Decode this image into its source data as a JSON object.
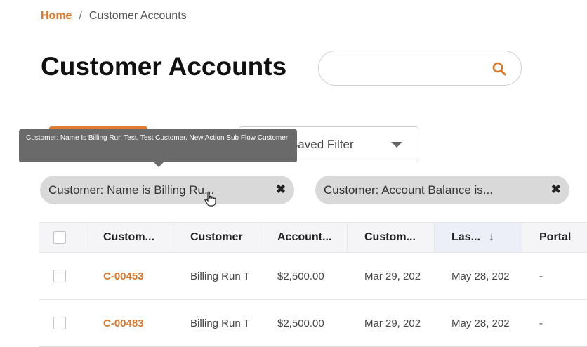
{
  "breadcrumb": {
    "home": "Home",
    "separator": "/",
    "current": "Customer Accounts"
  },
  "page_title": "Customer Accounts",
  "search": {
    "value": "",
    "placeholder": "",
    "icon": "search-icon"
  },
  "saved_filter": {
    "label": "Select Saved Filter",
    "visible_label": "Saved Filter"
  },
  "tooltip": {
    "text": "Customer: Name Is Billing Run Test, Test Customer, New Action Sub Flow Customer"
  },
  "filter_chips": [
    {
      "label": "Customer: Name is Billing Ru...",
      "close": "✖"
    },
    {
      "label": "Customer: Account Balance is...",
      "close": "✖"
    }
  ],
  "table": {
    "columns": [
      "Custom...",
      "Customer",
      "Account...",
      "Custom...",
      "Las...",
      "Portal"
    ],
    "sort_indicator": "↓",
    "rows": [
      {
        "id": "C-00453",
        "customer": "Billing Run T",
        "account_balance": "$2,500.00",
        "created": "Mar 29, 202",
        "last": "May 28, 202",
        "portal": "-"
      },
      {
        "id": "C-00483",
        "customer": "Billing Run T",
        "account_balance": "$2,500.00",
        "created": "Mar 29, 202",
        "last": "May 28, 202",
        "portal": "-"
      }
    ]
  },
  "colors": {
    "accent": "#d7772b",
    "chip_bg": "#d9d9d9",
    "tooltip_bg": "#6a6a6a",
    "header_bg": "#f5f5f7"
  }
}
